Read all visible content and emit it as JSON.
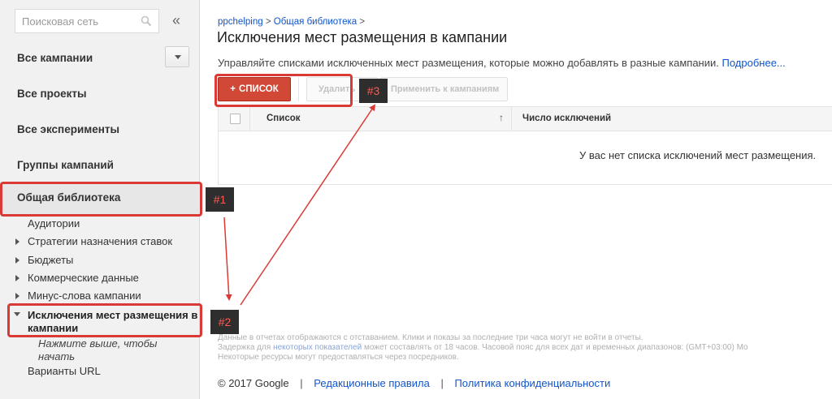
{
  "sidebar": {
    "search_placeholder": "Поисковая сеть",
    "collapse_label": "«",
    "nav": [
      "Все кампании",
      "Все проекты",
      "Все эксперименты",
      "Группы кампаний",
      "Общая библиотека"
    ],
    "library_items": [
      "Аудитории",
      "Стратегии назначения ставок",
      "Бюджеты",
      "Коммерческие данные",
      "Минус-слова кампании",
      "Исключения мест размещения в кампании"
    ],
    "hint": "Нажмите выше, чтобы начать",
    "url_variants": "Варианты URL"
  },
  "breadcrumb": {
    "account": "ppchelping",
    "separator": ">",
    "library": "Общая библиотека"
  },
  "page": {
    "title": "Исключения мест размещения в кампании",
    "description": "Управляйте списками исключенных мест размещения, которые можно добавлять в разные кампании.",
    "more_link": "Подробнее..."
  },
  "toolbar": {
    "add_list_plus": "+",
    "add_list_label": "СПИСОК",
    "delete_label": "Удалить",
    "apply_label": "Применить к кампаниям"
  },
  "table": {
    "col_list": "Список",
    "sort_arrow": "↑",
    "col_count": "Число исключений",
    "empty_message": "У вас нет списка исключений мест размещения."
  },
  "footnote": {
    "line1": "Данные в отчетах отображаются с отставанием. Клики и показы за последние три часа могут не войти в отчеты.",
    "line2_pre": "Задержка для",
    "line2_link": "некоторых показателей",
    "line2_post": "может составлять от 18 часов. Часовой пояс для всех дат и временных диапазонов: (GMT+03:00) Мо",
    "line3": "Некоторые ресурсы могут предоставляться через посредников."
  },
  "footer": {
    "copyright": "© 2017 Google",
    "pipe": "|",
    "editorial_link": "Редакционные правила",
    "privacy_link": "Политика конфиденциальности"
  },
  "annotations": {
    "marker1": "#1",
    "marker2": "#2",
    "marker3": "#3",
    "accent_color": "#d93a35"
  }
}
